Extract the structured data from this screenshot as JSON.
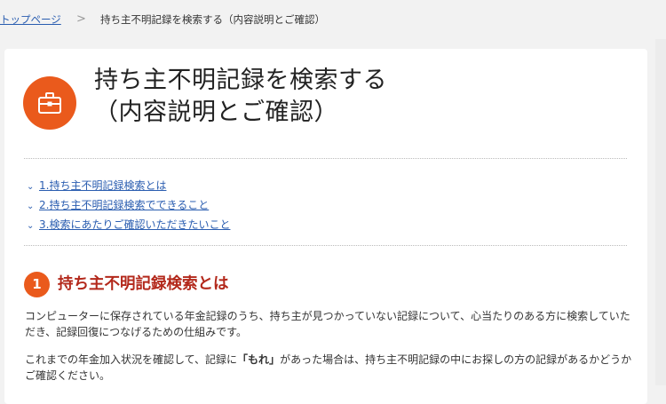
{
  "breadcrumb": {
    "home_label": "トップページ",
    "separator": ">",
    "current": "持ち主不明記録を検索する（内容説明とご確認）"
  },
  "page": {
    "title_line1": "持ち主不明記録を検索する",
    "title_line2": "（内容説明とご確認）",
    "icon": "toolbox-icon",
    "accent_color": "#ea5a1c",
    "heading_color": "#b3281b",
    "link_color": "#2a5db0"
  },
  "toc": [
    {
      "label": "1.持ち主不明記録検索とは",
      "icon": "chevron-down-icon"
    },
    {
      "label": "2.持ち主不明記録検索でできること",
      "icon": "chevron-down-icon"
    },
    {
      "label": "3.検索にあたりご確認いただきたいこと",
      "icon": "chevron-down-icon"
    }
  ],
  "section1": {
    "number": "1",
    "title": "持ち主不明記録検索とは",
    "para1_line1": "コンピューターに保存されている年金記録のうち、持ち主が見つかっていない記録について、心当たりのある方に検索していた",
    "para1_line2": "だき、記録回復につなげるための仕組みです。",
    "para2_pre": "これまでの年金加入状況を確認して、記録に",
    "para2_emph": "「もれ」",
    "para2_post": "があった場合は、持ち主不明記録の中にお探しの方の記録があるかどうか",
    "para2_line2": "ご確認ください。"
  }
}
